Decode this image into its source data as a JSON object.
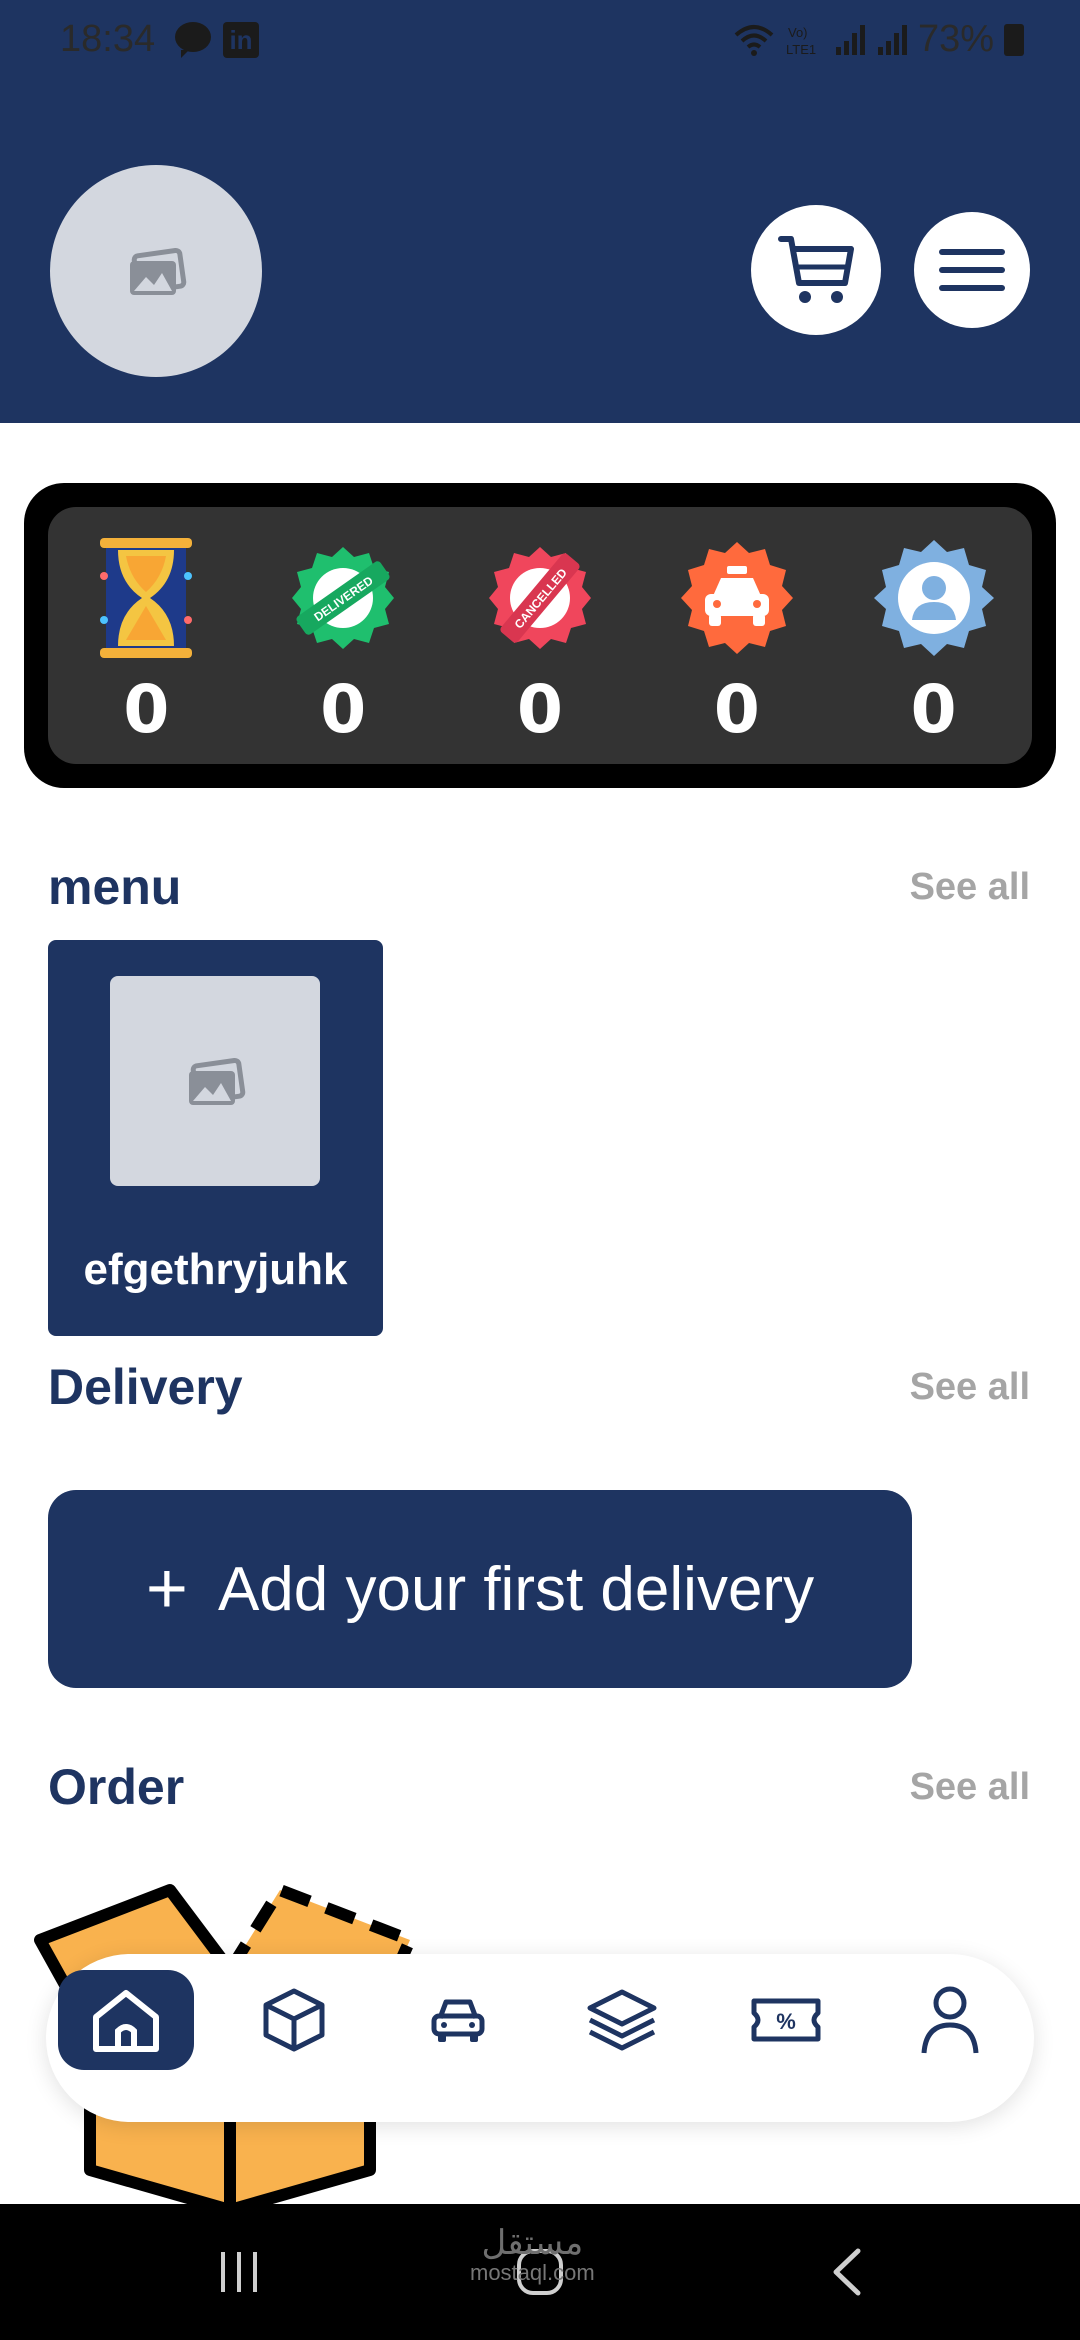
{
  "status_bar": {
    "time": "18:34",
    "battery": "73%",
    "network": "Vo) LTE1"
  },
  "header": {
    "avatar_icon": "image-placeholder-icon",
    "cart_icon": "cart-icon",
    "menu_icon": "hamburger-menu-icon"
  },
  "stats": [
    {
      "icon": "hourglass-icon",
      "value": "0"
    },
    {
      "icon": "delivered-badge-icon",
      "badge_text": "DELIVERED",
      "value": "0"
    },
    {
      "icon": "cancelled-badge-icon",
      "badge_text": "CANCELLED",
      "value": "0"
    },
    {
      "icon": "taxi-badge-icon",
      "value": "0"
    },
    {
      "icon": "user-badge-icon",
      "value": "0"
    }
  ],
  "sections": {
    "menu": {
      "title": "menu",
      "see_all": "See all"
    },
    "delivery": {
      "title": "Delivery",
      "see_all": "See all"
    },
    "order": {
      "title": "Order",
      "see_all": "See all"
    }
  },
  "menu_items": [
    {
      "label": "efgethryjuhk",
      "icon": "image-placeholder-icon"
    }
  ],
  "delivery": {
    "add_button_plus": "+",
    "add_button_label": "Add your first delivery"
  },
  "bottom_nav": [
    {
      "icon": "home-icon",
      "active": true
    },
    {
      "icon": "box-icon",
      "active": false
    },
    {
      "icon": "car-icon",
      "active": false
    },
    {
      "icon": "layers-icon",
      "active": false
    },
    {
      "icon": "coupon-icon",
      "active": false
    },
    {
      "icon": "profile-icon",
      "active": false
    }
  ],
  "system_nav": {
    "recents_icon": "recents-icon",
    "home_icon": "system-home-icon",
    "back_icon": "back-icon"
  },
  "watermark": {
    "arabic": "مستقل",
    "latin": "mostaql.com"
  },
  "colors": {
    "primary": "#1e3461",
    "stats_bg": "#333333",
    "see_all": "#a5a5a5"
  }
}
